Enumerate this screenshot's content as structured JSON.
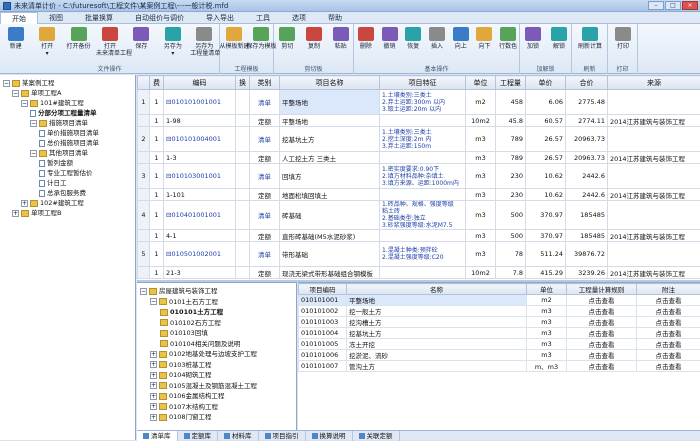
{
  "window": {
    "title": "未来清单计价 - C:\\futuresoft\\工程文件\\某案例工程\\---一般计税.mfd",
    "btn_min": "–",
    "btn_max": "□",
    "btn_close": "×"
  },
  "menu": [
    "开始",
    "视图",
    "批量换算",
    "自动组价与调价",
    "导入导出",
    "工具",
    "选项",
    "帮助"
  ],
  "ribbon": {
    "groups": [
      {
        "label": "文件操作",
        "buttons": [
          {
            "label": "新建",
            "sub": ""
          },
          {
            "label": "打开",
            "sub": "▾"
          },
          {
            "label": "打开备份",
            "sub": ""
          },
          {
            "label": "打开",
            "sub": "未来清单工程"
          },
          {
            "label": "保存",
            "sub": ""
          },
          {
            "label": "另存为",
            "sub": "▾"
          },
          {
            "label": "另存为",
            "sub": "工程量清单"
          }
        ]
      },
      {
        "label": "工程模板",
        "buttons": [
          {
            "label": "从模板新建",
            "sub": ""
          },
          {
            "label": "保存为模板",
            "sub": ""
          }
        ]
      },
      {
        "label": "剪切板",
        "buttons": [
          {
            "label": "剪切",
            "sub": ""
          },
          {
            "label": "复制",
            "sub": ""
          },
          {
            "label": "粘贴",
            "sub": ""
          }
        ]
      },
      {
        "label": "基本操作",
        "buttons": [
          {
            "label": "删除",
            "sub": ""
          },
          {
            "label": "撤销",
            "sub": ""
          },
          {
            "label": "恢复",
            "sub": ""
          },
          {
            "label": "插入",
            "sub": ""
          },
          {
            "label": "向上",
            "sub": ""
          },
          {
            "label": "向下",
            "sub": ""
          },
          {
            "label": "行数色",
            "sub": ""
          }
        ]
      },
      {
        "label": "加解锁",
        "buttons": [
          {
            "label": "加锁",
            "sub": ""
          },
          {
            "label": "解锁",
            "sub": ""
          }
        ]
      },
      {
        "label": "刷新",
        "buttons": [
          {
            "label": "刷新计算",
            "sub": ""
          }
        ]
      },
      {
        "label": "打印",
        "buttons": [
          {
            "label": "打印",
            "sub": ""
          }
        ]
      }
    ]
  },
  "left_tree": [
    {
      "indent": 0,
      "toggle": "−",
      "icon": "folder",
      "label": "某案例工程",
      "bold": false
    },
    {
      "indent": 1,
      "toggle": "−",
      "icon": "folder",
      "label": "单项工程A",
      "bold": false
    },
    {
      "indent": 2,
      "toggle": "−",
      "icon": "folder",
      "label": "101#建筑工程",
      "bold": false
    },
    {
      "indent": 3,
      "toggle": "",
      "icon": "doc",
      "label": "分部分项工程量清单",
      "bold": true
    },
    {
      "indent": 3,
      "toggle": "−",
      "icon": "folder",
      "label": "措施项目清单",
      "bold": false
    },
    {
      "indent": 4,
      "toggle": "",
      "icon": "doc",
      "label": "单价措施项目清单",
      "bold": false
    },
    {
      "indent": 4,
      "toggle": "",
      "icon": "doc",
      "label": "总价措施项目清单",
      "bold": false
    },
    {
      "indent": 3,
      "toggle": "−",
      "icon": "folder",
      "label": "其他项目清单",
      "bold": false
    },
    {
      "indent": 4,
      "toggle": "",
      "icon": "doc",
      "label": "暂列金额",
      "bold": false
    },
    {
      "indent": 4,
      "toggle": "",
      "icon": "doc",
      "label": "专业工程暂估价",
      "bold": false
    },
    {
      "indent": 4,
      "toggle": "",
      "icon": "doc",
      "label": "计日工",
      "bold": false
    },
    {
      "indent": 4,
      "toggle": "",
      "icon": "doc",
      "label": "总承包服务费",
      "bold": false
    },
    {
      "indent": 2,
      "toggle": "+",
      "icon": "folder",
      "label": "102#建筑工程",
      "bold": false
    },
    {
      "indent": 1,
      "toggle": "+",
      "icon": "folder",
      "label": "单项工程B",
      "bold": false
    }
  ],
  "grid": {
    "headers": [
      "",
      "费",
      "编码",
      "换",
      "类别",
      "项目名称",
      "项目特征",
      "单位",
      "工程量",
      "单价",
      "合价",
      "来源"
    ],
    "rows": [
      {
        "type": "main",
        "num": "1",
        "fee": "1",
        "code": "⊟010101001001",
        "huan": "",
        "cat": "清单",
        "name": "平整场地",
        "feat": "1.土壤类别:三类土\n2.弃土运距:300m 以内\n3.取土运距:20m 以内",
        "unit": "m2",
        "qty": "458",
        "price": "6.06",
        "total": "2775.48",
        "src": "",
        "sel": true
      },
      {
        "type": "sub",
        "num": "",
        "fee": "1",
        "code": "1-98",
        "huan": "",
        "cat": "定额",
        "name": "平整场地",
        "feat": "",
        "unit": "10m2",
        "qty": "45.8",
        "price": "60.57",
        "total": "2774.11",
        "src": "2014江苏建筑与装饰工程",
        "sel": false
      },
      {
        "type": "main",
        "num": "2",
        "fee": "1",
        "code": "⊟010101004001",
        "huan": "",
        "cat": "清单",
        "name": "挖基坑土方",
        "feat": "1.土壤类别:三类土\n2.挖土深度:2m 内\n3.弃土运距:150m",
        "unit": "m3",
        "qty": "789",
        "price": "26.57",
        "total": "20963.73",
        "src": "",
        "sel": false
      },
      {
        "type": "sub",
        "num": "",
        "fee": "1",
        "code": "1-3",
        "huan": "",
        "cat": "定额",
        "name": "人工挖土方 三类土",
        "feat": "",
        "unit": "m3",
        "qty": "789",
        "price": "26.57",
        "total": "20963.73",
        "src": "2014江苏建筑与装饰工程",
        "sel": false
      },
      {
        "type": "main",
        "num": "3",
        "fee": "1",
        "code": "⊟010103001001",
        "huan": "",
        "cat": "清单",
        "name": "回填方",
        "feat": "1.密实度要求:0.90下\n2.填方材料品种:杂填土\n3.填方来源、运距:1000m内",
        "unit": "m3",
        "qty": "230",
        "price": "10.62",
        "total": "2442.6",
        "src": "",
        "sel": false
      },
      {
        "type": "sub",
        "num": "",
        "fee": "1",
        "code": "1-101",
        "huan": "",
        "cat": "定额",
        "name": "地面松填回填土",
        "feat": "",
        "unit": "m3",
        "qty": "230",
        "price": "10.62",
        "total": "2442.6",
        "src": "2014江苏建筑与装饰工程",
        "sel": false
      },
      {
        "type": "main",
        "num": "4",
        "fee": "1",
        "code": "⊟010401001001",
        "huan": "",
        "cat": "清单",
        "name": "砖基础",
        "feat": "1.砖品种、规格、强度等级\n粘土砖\n2.基础类型:独立\n3.砂浆强度等级:水泥M7.5",
        "unit": "m3",
        "qty": "500",
        "price": "370.97",
        "total": "185485",
        "src": "",
        "sel": false
      },
      {
        "type": "sub",
        "num": "",
        "fee": "1",
        "code": "4-1",
        "huan": "",
        "cat": "定额",
        "name": "直形砖基础(M5水泥砂浆)",
        "feat": "",
        "unit": "m3",
        "qty": "500",
        "price": "370.97",
        "total": "185485",
        "src": "2014江苏建筑与装饰工程",
        "sel": false
      },
      {
        "type": "main",
        "num": "5",
        "fee": "1",
        "code": "⊟010501002001",
        "huan": "",
        "cat": "清单",
        "name": "带形基础",
        "feat": "1.混凝土种类:预拌砼\n2.混凝土强度等级:C20",
        "unit": "m3",
        "qty": "78",
        "price": "511.24",
        "total": "39876.72",
        "src": "",
        "sel": false
      },
      {
        "type": "sub",
        "num": "",
        "fee": "1",
        "code": "21-3",
        "huan": "",
        "cat": "定额",
        "name": "现浇无梁式带形基础组合钢模板",
        "feat": "",
        "unit": "10m2",
        "qty": "7.8",
        "price": "415.29",
        "total": "3239.26",
        "src": "2014江苏建筑与装饰工程",
        "sel": false
      }
    ]
  },
  "lib_tree": [
    {
      "indent": 0,
      "toggle": "−",
      "label": "房屋建筑与装饰工程",
      "bold": false
    },
    {
      "indent": 1,
      "toggle": "−",
      "label": "0101土石方工程",
      "bold": false
    },
    {
      "indent": 2,
      "toggle": "",
      "label": "010101土方工程",
      "bold": true
    },
    {
      "indent": 2,
      "toggle": "",
      "label": "010102石方工程",
      "bold": false
    },
    {
      "indent": 2,
      "toggle": "",
      "label": "010103回填",
      "bold": false
    },
    {
      "indent": 2,
      "toggle": "",
      "label": "010104相关问题及说明",
      "bold": false
    },
    {
      "indent": 1,
      "toggle": "+",
      "label": "0102地基处理与边坡支护工程",
      "bold": false
    },
    {
      "indent": 1,
      "toggle": "+",
      "label": "0103桩基工程",
      "bold": false
    },
    {
      "indent": 1,
      "toggle": "+",
      "label": "0104砌筑工程",
      "bold": false
    },
    {
      "indent": 1,
      "toggle": "+",
      "label": "0105混凝土及钢筋混凝土工程",
      "bold": false
    },
    {
      "indent": 1,
      "toggle": "+",
      "label": "0106金属结构工程",
      "bold": false
    },
    {
      "indent": 1,
      "toggle": "+",
      "label": "0107木结构工程",
      "bold": false
    },
    {
      "indent": 1,
      "toggle": "+",
      "label": "0108门窗工程",
      "bold": false
    }
  ],
  "lib": {
    "headers": [
      "项目编码",
      "名称",
      "单位",
      "工程量计算规则",
      "附注"
    ],
    "rows": [
      {
        "code": "010101001",
        "name": "平整场地",
        "unit": "m2",
        "rule": "点击查看",
        "note": "点击查看",
        "sel": true
      },
      {
        "code": "010101002",
        "name": "挖一般土方",
        "unit": "m3",
        "rule": "点击查看",
        "note": "点击查看",
        "sel": false
      },
      {
        "code": "010101003",
        "name": "挖沟槽土方",
        "unit": "m3",
        "rule": "点击查看",
        "note": "点击查看",
        "sel": false
      },
      {
        "code": "010101004",
        "name": "挖基坑土方",
        "unit": "m3",
        "rule": "点击查看",
        "note": "点击查看",
        "sel": false
      },
      {
        "code": "010101005",
        "name": "冻土开挖",
        "unit": "m3",
        "rule": "点击查看",
        "note": "点击查看",
        "sel": false
      },
      {
        "code": "010101006",
        "name": "挖淤泥、流砂",
        "unit": "m3",
        "rule": "点击查看",
        "note": "点击查看",
        "sel": false
      },
      {
        "code": "010101007",
        "name": "管沟土方",
        "unit": "m、m3",
        "rule": "点击查看",
        "note": "点击查看",
        "sel": false
      }
    ]
  },
  "tabs": [
    "清单库",
    "定额库",
    "材料库",
    "项目指引",
    "换算说明",
    "关联定额"
  ],
  "colors": {
    "accent": "#2e6fb7",
    "link": "#1c3ea8",
    "selection": "#dbe7fb"
  }
}
